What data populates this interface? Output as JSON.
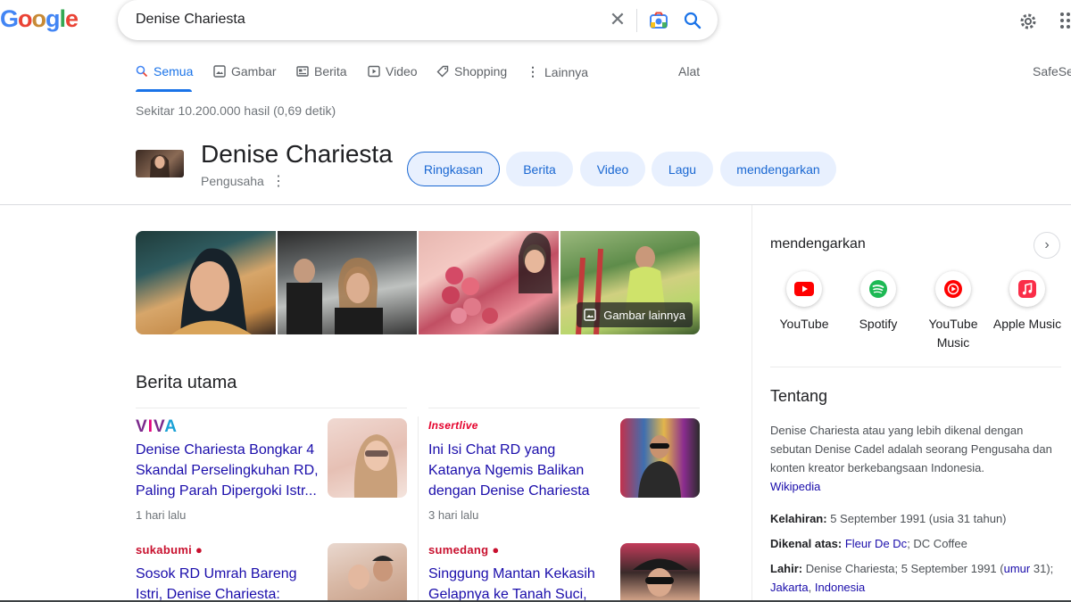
{
  "logo": {
    "letters": [
      "G",
      "o",
      "o",
      "g",
      "l",
      "e"
    ]
  },
  "search": {
    "query": "Denise Chariesta"
  },
  "tabs": [
    {
      "label": "Semua",
      "icon": "search-icon"
    },
    {
      "label": "Gambar",
      "icon": "image-icon"
    },
    {
      "label": "Berita",
      "icon": "news-icon"
    },
    {
      "label": "Video",
      "icon": "video-icon"
    },
    {
      "label": "Shopping",
      "icon": "tag-icon"
    },
    {
      "label": "Lainnya",
      "icon": "more-vert-icon"
    }
  ],
  "tools_label": "Alat",
  "safesearch_label": "SafeSe",
  "stats": "Sekitar 10.200.000 hasil (0,69 detik)",
  "entity": {
    "title": "Denise Chariesta",
    "subtitle": "Pengusaha",
    "chips": [
      "Ringkasan",
      "Berita",
      "Video",
      "Lagu",
      "mendengarkan"
    ]
  },
  "images": {
    "more_label": "Gambar lainnya"
  },
  "news": {
    "heading": "Berita utama",
    "items": [
      {
        "source": "VIVA",
        "title": "Denise Chariesta Bongkar 4 Skandal Perselingkuhan RD, Paling Parah Dipergoki Istr...",
        "time": "1 hari lalu"
      },
      {
        "source": "Insertlive",
        "title": "Ini Isi Chat RD yang Katanya Ngemis Balikan dengan Denise Chariesta",
        "time": "3 hari lalu"
      },
      {
        "source": "sukabumi",
        "title": "Sosok RD Umrah Bareng Istri, Denise Chariesta:",
        "time": ""
      },
      {
        "source": "sumedang",
        "title": "Singgung Mantan Kekasih Gelapnya ke Tanah Suci,",
        "time": ""
      }
    ]
  },
  "right_panel": {
    "listen_title": "mendengarkan",
    "services": [
      {
        "label": "YouTube",
        "icon": "youtube-icon",
        "color": "#ff0000"
      },
      {
        "label": "Spotify",
        "icon": "spotify-icon",
        "color": "#1db954"
      },
      {
        "label": "YouTube Music",
        "icon": "youtube-music-icon",
        "color": "#ff0000"
      },
      {
        "label": "Apple Music",
        "icon": "apple-music-icon",
        "color": "#fa2d48"
      }
    ],
    "about_heading": "Tentang",
    "about_text": "Denise Chariesta atau yang lebih dikenal dengan sebutan Denise Cadel adalah seorang Pengusaha dan konten kreator berkebangsaan Indonesia.",
    "about_source": "Wikipedia",
    "facts": {
      "born_label": "Kelahiran:",
      "born_value": "5 September 1991 (usia 31 tahun)",
      "known_label": "Dikenal atas:",
      "known_link": "Fleur De Dc",
      "known_rest": "; DC Coffee",
      "birth_label": "Lahir:",
      "birth_value": "Denise Chariesta; 5 September 1991 (",
      "birth_link_age": "umur",
      "birth_age_rest": "31);",
      "birth_link_city": "Jakarta",
      "birth_comma": ",",
      "birth_link_country": "Indonesia"
    }
  },
  "colors": {
    "accent": "#1a73e8",
    "link": "#1a0dab",
    "chip_bg": "#e8f0fe"
  }
}
